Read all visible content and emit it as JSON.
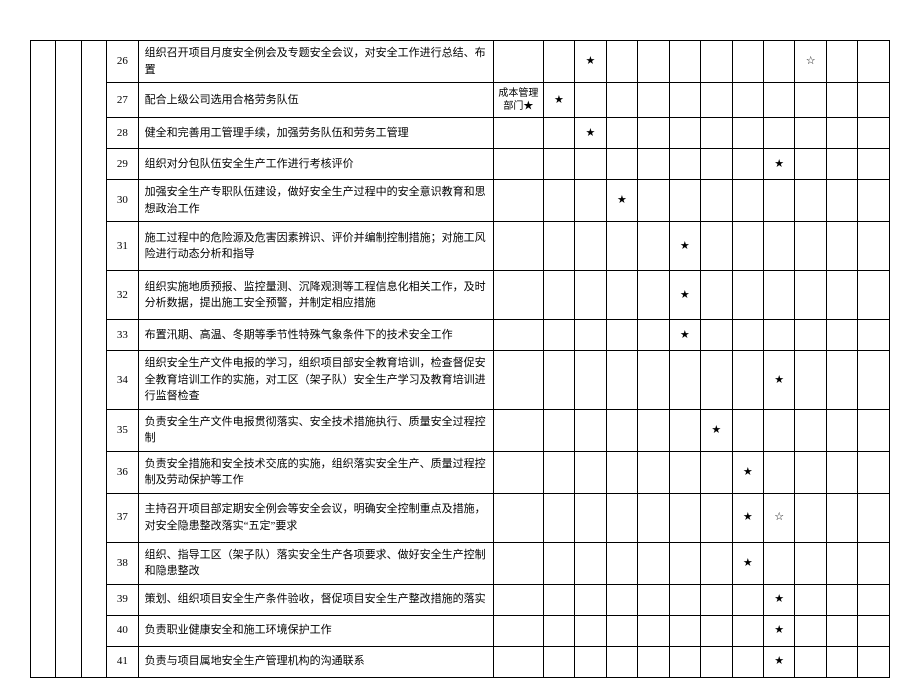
{
  "symbols": {
    "filledStar": "★",
    "openStar": "☆"
  },
  "leftBlank": "",
  "extraLabel": "成本管理部门★",
  "rows": [
    {
      "num": "26",
      "desc": "组织召开项目月度安全例会及专题安全会议，对安全工作进行总结、布置",
      "marks": [
        "",
        "★",
        "",
        "",
        "",
        "",
        "",
        "",
        "☆",
        "",
        ""
      ]
    },
    {
      "num": "27",
      "desc": "配合上级公司选用合格劳务队伍",
      "extra": true,
      "marks": [
        "★",
        "",
        "",
        "",
        "",
        "",
        "",
        "",
        "",
        "",
        ""
      ]
    },
    {
      "num": "28",
      "desc": "健全和完善用工管理手续，加强劳务队伍和劳务工管理",
      "marks": [
        "",
        "★",
        "",
        "",
        "",
        "",
        "",
        "",
        "",
        "",
        ""
      ]
    },
    {
      "num": "29",
      "desc": "组织对分包队伍安全生产工作进行考核评价",
      "marks": [
        "",
        "",
        "",
        "",
        "",
        "",
        "",
        "★",
        "",
        "",
        ""
      ]
    },
    {
      "num": "30",
      "desc": "加强安全生产专职队伍建设，做好安全生产过程中的安全意识教育和思想政治工作",
      "marks": [
        "",
        "",
        "★",
        "",
        "",
        "",
        "",
        "",
        "",
        "",
        ""
      ]
    },
    {
      "num": "31",
      "desc": "施工过程中的危险源及危害因素辨识、评价并编制控制措施；对施工风险进行动态分析和指导",
      "marks": [
        "",
        "",
        "",
        "",
        "★",
        "",
        "",
        "",
        "",
        "",
        ""
      ]
    },
    {
      "num": "32",
      "desc": "组织实施地质预报、监控量测、沉降观测等工程信息化相关工作，及时分析数据，提出施工安全预警，并制定相应措施",
      "marks": [
        "",
        "",
        "",
        "",
        "★",
        "",
        "",
        "",
        "",
        "",
        ""
      ]
    },
    {
      "num": "33",
      "desc": "布置汛期、高温、冬期等季节性特殊气象条件下的技术安全工作",
      "marks": [
        "",
        "",
        "",
        "",
        "★",
        "",
        "",
        "",
        "",
        "",
        ""
      ]
    },
    {
      "num": "34",
      "desc": "组织安全生产文件电报的学习，组织项目部安全教育培训，检查督促安全教育培训工作的实施，对工区（架子队）安全生产学习及教育培训进行监督检查",
      "marks": [
        "",
        "",
        "",
        "",
        "",
        "",
        "",
        "★",
        "",
        "",
        ""
      ]
    },
    {
      "num": "35",
      "desc": "负责安全生产文件电报贯彻落实、安全技术措施执行、质量安全过程控制",
      "marks": [
        "",
        "",
        "",
        "",
        "",
        "★",
        "",
        "",
        "",
        "",
        ""
      ]
    },
    {
      "num": "36",
      "desc": "负责安全措施和安全技术交底的实施，组织落实安全生产、质量过程控制及劳动保护等工作",
      "marks": [
        "",
        "",
        "",
        "",
        "",
        "",
        "★",
        "",
        "",
        "",
        ""
      ]
    },
    {
      "num": "37",
      "desc": "主持召开项目部定期安全例会等安全会议，明确安全控制重点及措施，对安全隐患整改落实“五定”要求",
      "marks": [
        "",
        "",
        "",
        "",
        "",
        "",
        "★",
        "☆",
        "",
        "",
        ""
      ]
    },
    {
      "num": "38",
      "desc": "组织、指导工区（架子队）落实安全生产各项要求、做好安全生产控制和隐患整改",
      "marks": [
        "",
        "",
        "",
        "",
        "",
        "",
        "★",
        "",
        "",
        "",
        ""
      ]
    },
    {
      "num": "39",
      "desc": "策划、组织项目安全生产条件验收，督促项目安全生产整改措施的落实",
      "marks": [
        "",
        "",
        "",
        "",
        "",
        "",
        "",
        "★",
        "",
        "",
        ""
      ]
    },
    {
      "num": "40",
      "desc": "负责职业健康安全和施工环境保护工作",
      "marks": [
        "",
        "",
        "",
        "",
        "",
        "",
        "",
        "★",
        "",
        "",
        ""
      ]
    },
    {
      "num": "41",
      "desc": "负责与项目属地安全生产管理机构的沟通联系",
      "marks": [
        "",
        "",
        "",
        "",
        "",
        "",
        "",
        "★",
        "",
        "",
        ""
      ]
    }
  ]
}
